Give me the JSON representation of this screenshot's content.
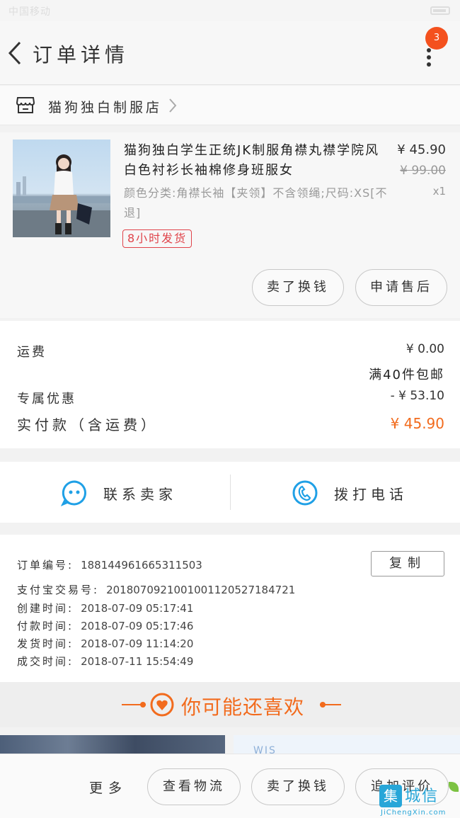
{
  "status_bar": {
    "carrier": "中国移动",
    "time": ""
  },
  "header": {
    "title": "订单详情",
    "badge_count": "3"
  },
  "shop": {
    "name": "猫狗独白制服店"
  },
  "product": {
    "title": "猫狗独白学生正统JK制服角襟丸襟学院风白色衬衫长袖棉修身班服女",
    "spec": "颜色分类:角襟长袖【夹领】不含领绳;尺码:XS[不退]",
    "ship_tag": "8小时发货",
    "price": "¥ 45.90",
    "original_price": "¥ 99.00",
    "quantity": "x1",
    "actions": [
      "卖了换钱",
      "申请售后"
    ]
  },
  "costs": {
    "shipping_label": "运费",
    "shipping_value": "¥ 0.00",
    "free_shipping_note": "满40件包邮",
    "discount_label": "专属优惠",
    "discount_value": "- ¥ 53.10",
    "paid_label": "实付款（含运费）",
    "paid_value": "¥ 45.90"
  },
  "contact": {
    "seller_label": "联系卖家",
    "phone_label": "拨打电话"
  },
  "order_info": {
    "copy_label": "复制",
    "rows": [
      {
        "key": "订单编号:",
        "value": "188144961665311503"
      },
      {
        "key": "支付宝交易号:",
        "value": "2018070921001001120527184721"
      },
      {
        "key": "创建时间:",
        "value": "2018-07-09 05:17:41"
      },
      {
        "key": "付款时间:",
        "value": "2018-07-09 05:17:46"
      },
      {
        "key": "发货时间:",
        "value": "2018-07-09 11:14:20"
      },
      {
        "key": "成交时间:",
        "value": "2018-07-11 15:54:49"
      }
    ]
  },
  "recommend": {
    "title": "你可能还喜欢",
    "right_image_text": "WIS"
  },
  "bottom_bar": {
    "more_label": "更多",
    "buttons": [
      "查看物流",
      "卖了换钱",
      "追加评价"
    ]
  },
  "watermark": {
    "title": "城信",
    "icon_char": "集",
    "subtitle": "JiChengXin.com"
  },
  "colors": {
    "accent": "#f26b1d",
    "badge": "#f4511e",
    "contact_icon": "#1fa0e6",
    "ship_tag": "#e0434a"
  }
}
